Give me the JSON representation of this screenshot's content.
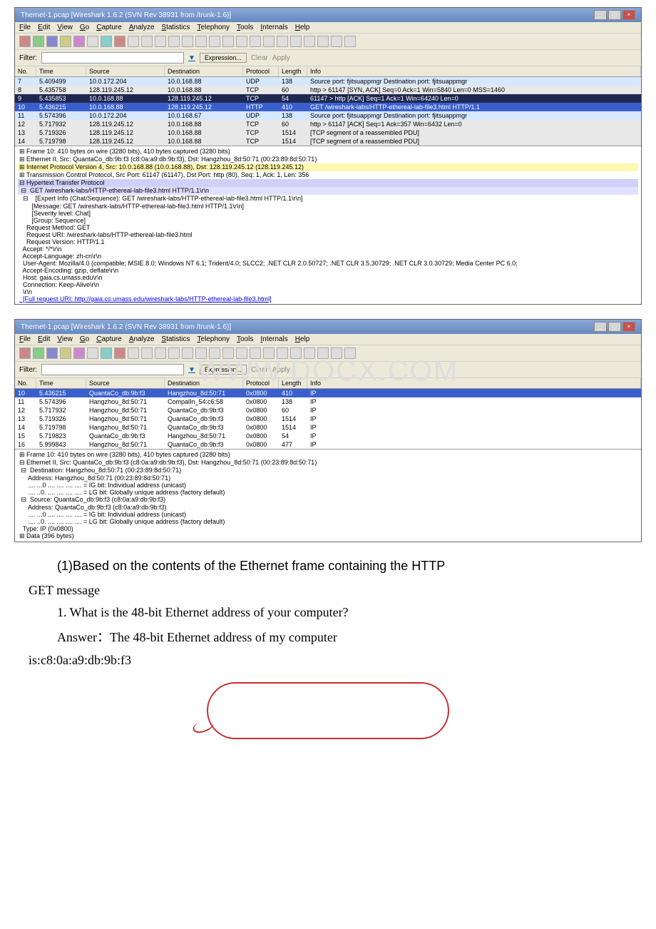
{
  "window1": {
    "title": "Thernet-1.pcap  [Wireshark 1.6.2 (SVN Rev 38931 from /trunk-1.6)]",
    "menu": [
      "File",
      "Edit",
      "View",
      "Go",
      "Capture",
      "Analyze",
      "Statistics",
      "Telephony",
      "Tools",
      "Internals",
      "Help"
    ],
    "filter_label": "Filter:",
    "expression_btn": "Expression...",
    "clear_btn": "Clear",
    "apply_btn": "Apply",
    "columns": {
      "no": "No.",
      "time": "Time",
      "src": "Source",
      "dst": "Destination",
      "proto": "Protocol",
      "len": "Length",
      "info": "Info"
    },
    "rows": [
      {
        "no": "7",
        "time": "5.409499",
        "src": "10.0.172.204",
        "dst": "10.0.168.88",
        "proto": "UDP",
        "len": "138",
        "info": "Source port: fjitsuappmgr  Destination port: fjitsuappmgr",
        "cls": "bg-udp"
      },
      {
        "no": "8",
        "time": "5.435758",
        "src": "128.119.245.12",
        "dst": "10.0.168.88",
        "proto": "TCP",
        "len": "60",
        "info": "http > 61147 [SYN, ACK] Seq=0 Ack=1 Win=5840 Len=0 MSS=1460",
        "cls": "bg-tcp"
      },
      {
        "no": "9",
        "time": "5.435853",
        "src": "10.0.168.88",
        "dst": "128.119.245.12",
        "proto": "TCP",
        "len": "54",
        "info": "61147 > http [ACK] Seq=1 Ack=1 Win=64240 Len=0",
        "cls": "sel-dark"
      },
      {
        "no": "10",
        "time": "5.436215",
        "src": "10.0.168.88",
        "dst": "128.119.245.12",
        "proto": "HTTP",
        "len": "410",
        "info": "GET /wireshark-labs/HTTP-ethereal-lab-file3.html HTTP/1.1",
        "cls": "sel-blue"
      },
      {
        "no": "11",
        "time": "5.574396",
        "src": "10.0.172.204",
        "dst": "10.0.168.67",
        "proto": "UDP",
        "len": "138",
        "info": "Source port: fjitsuappmgr  Destination port: fjitsuappmgr",
        "cls": "bg-udp"
      },
      {
        "no": "12",
        "time": "5.717932",
        "src": "128.119.245.12",
        "dst": "10.0.168.88",
        "proto": "TCP",
        "len": "60",
        "info": "http > 61147 [ACK] Seq=1 Ack=357 Win=6432 Len=0",
        "cls": "bg-tcp"
      },
      {
        "no": "13",
        "time": "5.719326",
        "src": "128.119.245.12",
        "dst": "10.0.168.88",
        "proto": "TCP",
        "len": "1514",
        "info": "[TCP segment of a reassembled PDU]",
        "cls": "bg-tcp"
      },
      {
        "no": "14",
        "time": "5.719798",
        "src": "128.119.245.12",
        "dst": "10.0.168.88",
        "proto": "TCP",
        "len": "1514",
        "info": "[TCP segment of a reassembled PDU]",
        "cls": "bg-tcp"
      }
    ],
    "details": [
      {
        "t": "Frame 10: 410 bytes on wire (3280 bits), 410 bytes captured (3280 bits)",
        "pre": "⊞ "
      },
      {
        "t": "Ethernet II, Src: QuantaCo_db:9b:f3 (c8:0a:a9:db:9b:f3), Dst: Hangzhou_8d:50:71 (00:23:89:8d:50:71)",
        "pre": "⊞ "
      },
      {
        "t": "Internet Protocol Version 4, Src: 10.0.168.88 (10.0.168.88), Dst: 128.119.245.12 (128.119.245.12)",
        "pre": "⊞ ",
        "cls": "dt-hl1"
      },
      {
        "t": "Transmission Control Protocol, Src Port: 61147 (61147), Dst Port: http (80), Seq: 1, Ack: 1, Len: 356",
        "pre": "⊞ "
      },
      {
        "t": "Hypertext Transfer Protocol",
        "pre": "⊟ ",
        "cls": "dt-hl3"
      },
      {
        "t": "  GET /wireshark-labs/HTTP-ethereal-lab-file3.html HTTP/1.1\\r\\n",
        "pre": " ⊟",
        "cls": "dt-hl2"
      },
      {
        "t": "    [Expert Info (Chat/Sequence): GET /wireshark-labs/HTTP-ethereal-lab-file3.html HTTP/1.1\\r\\n]",
        "pre": "  ⊟"
      },
      {
        "t": "       [Message: GET /wireshark-labs/HTTP-ethereal-lab-file3.html HTTP/1.1\\r\\n]",
        "pre": ""
      },
      {
        "t": "       [Severity level: Chat]",
        "pre": ""
      },
      {
        "t": "       [Group: Sequence]",
        "pre": ""
      },
      {
        "t": "    Request Method: GET",
        "pre": ""
      },
      {
        "t": "    Request URI: /wireshark-labs/HTTP-ethereal-lab-file3.html",
        "pre": ""
      },
      {
        "t": "    Request Version: HTTP/1.1",
        "pre": ""
      },
      {
        "t": "  Accept: */*\\r\\n",
        "pre": ""
      },
      {
        "t": "  Accept-Language: zh-cn\\r\\n",
        "pre": ""
      },
      {
        "t": "  User-Agent: Mozilla/4.0 (compatible; MSIE 8.0; Windows NT 6.1; Trident/4.0; SLCC2; .NET CLR 2.0.50727; .NET CLR 3.5.30729; .NET CLR 3.0.30729; Media Center PC 6.0;",
        "pre": ""
      },
      {
        "t": "  Accept-Encoding: gzip, deflate\\r\\n",
        "pre": ""
      },
      {
        "t": "  Host: gaia.cs.umass.edu\\r\\n",
        "pre": ""
      },
      {
        "t": "  Connection: Keep-Alive\\r\\n",
        "pre": ""
      },
      {
        "t": "  \\r\\n",
        "pre": ""
      },
      {
        "t": "  [Full request URI: http://gaia.cs.umass.edu/wireshark-labs/HTTP-ethereal-lab-file3.html]",
        "pre": "",
        "cls": "dt-link"
      }
    ]
  },
  "window2": {
    "title": "Thernet-1.pcap  [Wireshark 1.6.2 (SVN Rev 38931 from /trunk-1.6)]",
    "menu": [
      "File",
      "Edit",
      "View",
      "Go",
      "Capture",
      "Analyze",
      "Statistics",
      "Telephony",
      "Tools",
      "Internals",
      "Help"
    ],
    "filter_label": "Filter:",
    "expression_btn": "Expression...",
    "clear_btn": "Clear",
    "apply_btn": "Apply",
    "watermark": "WWW.DOCX.COM",
    "columns": {
      "no": "No.",
      "time": "Time",
      "src": "Source",
      "dst": "Destination",
      "proto": "Protocol",
      "len": "Length",
      "info": "Info"
    },
    "rows": [
      {
        "no": "10",
        "time": "5.436215",
        "src": "QuantaCo_db:9b:f3",
        "dst": "Hangzhou_8d:50:71",
        "proto": "0x0800",
        "len": "410",
        "info": "IP",
        "cls": "sel-blue"
      },
      {
        "no": "11",
        "time": "5.574396",
        "src": "Hangzhou_8d:50:71",
        "dst": "CompalIn_54:c6:58",
        "proto": "0x0800",
        "len": "138",
        "info": "IP"
      },
      {
        "no": "12",
        "time": "5.717932",
        "src": "Hangzhou_8d:50:71",
        "dst": "QuantaCo_db:9b:f3",
        "proto": "0x0800",
        "len": "60",
        "info": "IP"
      },
      {
        "no": "13",
        "time": "5.719326",
        "src": "Hangzhou_8d:50:71",
        "dst": "QuantaCo_db:9b:f3",
        "proto": "0x0800",
        "len": "1514",
        "info": "IP"
      },
      {
        "no": "14",
        "time": "5.719798",
        "src": "Hangzhou_8d:50:71",
        "dst": "QuantaCo_db:9b:f3",
        "proto": "0x0800",
        "len": "1514",
        "info": "IP"
      },
      {
        "no": "15",
        "time": "5.719823",
        "src": "QuantaCo_db:9b:f3",
        "dst": "Hangzhou_8d:50:71",
        "proto": "0x0800",
        "len": "54",
        "info": "IP"
      },
      {
        "no": "16",
        "time": "5.999843",
        "src": "Hangzhou_8d:50:71",
        "dst": "QuantaCo_db:9b:f3",
        "proto": "0x0800",
        "len": "477",
        "info": "IP"
      }
    ],
    "details": [
      {
        "t": "Frame 10: 410 bytes on wire (3280 bits), 410 bytes captured (3280 bits)",
        "pre": "⊞ "
      },
      {
        "t": "Ethernet II, Src: QuantaCo_db:9b:f3 (c8:0a:a9:db:9b:f3), Dst: Hangzhou_8d:50:71 (00:23:89:8d:50:71)",
        "pre": "⊟ "
      },
      {
        "t": "  Destination: Hangzhou_8d:50:71 (00:23:89:8d:50:71)",
        "pre": " ⊟"
      },
      {
        "t": "     Address: Hangzhou_8d:50:71 (00:23:89:8d:50:71)",
        "pre": ""
      },
      {
        "t": "     .... ...0 .... .... .... .... = IG bit: Individual address (unicast)",
        "pre": ""
      },
      {
        "t": "     .... ..0. .... .... .... .... = LG bit: Globally unique address (factory default)",
        "pre": ""
      },
      {
        "t": "  Source: QuantaCo_db:9b:f3 (c8:0a:a9:db:9b:f3)",
        "pre": " ⊟"
      },
      {
        "t": "     Address: QuantaCo_db:9b:f3 (c8:0a:a9:db:9b:f3)",
        "pre": ""
      },
      {
        "t": "     .... ...0 .... .... .... .... = IG bit: Individual address (unicast)",
        "pre": ""
      },
      {
        "t": "     .... ..0. .... .... .... .... = LG bit: Globally unique address (factory default)",
        "pre": ""
      },
      {
        "t": "  Type: IP (0x0800)",
        "pre": ""
      },
      {
        "t": "Data (396 bytes)",
        "pre": "⊞ "
      }
    ]
  },
  "doc": {
    "p1a": "(1)Based on the contents of the Ethernet frame containing the HTTP",
    "p1b": "GET message",
    "q1": "1. What is the 48-bit Ethernet address of your computer?",
    "a1a": "Answer：The 48-bit Ethernet address of my computer",
    "a1b": "is:c8:0a:a9:db:9b:f3"
  }
}
